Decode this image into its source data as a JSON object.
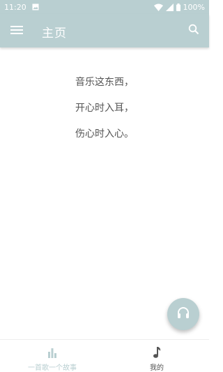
{
  "status_bar": {
    "time": "11:20",
    "battery": "100%"
  },
  "app_bar": {
    "title": "主页"
  },
  "poem": {
    "lines": [
      "音乐这东西，",
      "开心时入耳，",
      "伤心时入心。"
    ]
  },
  "bottom_nav": {
    "items": [
      {
        "label": "一首歌一个故事",
        "icon": "bar-chart-icon",
        "active": true
      },
      {
        "label": "我的",
        "icon": "music-note-icon",
        "active": false
      }
    ]
  },
  "fab": {
    "icon": "headphones-icon"
  },
  "colors": {
    "primary": "#b9cfd1",
    "text": "#555555",
    "white": "#ffffff"
  }
}
